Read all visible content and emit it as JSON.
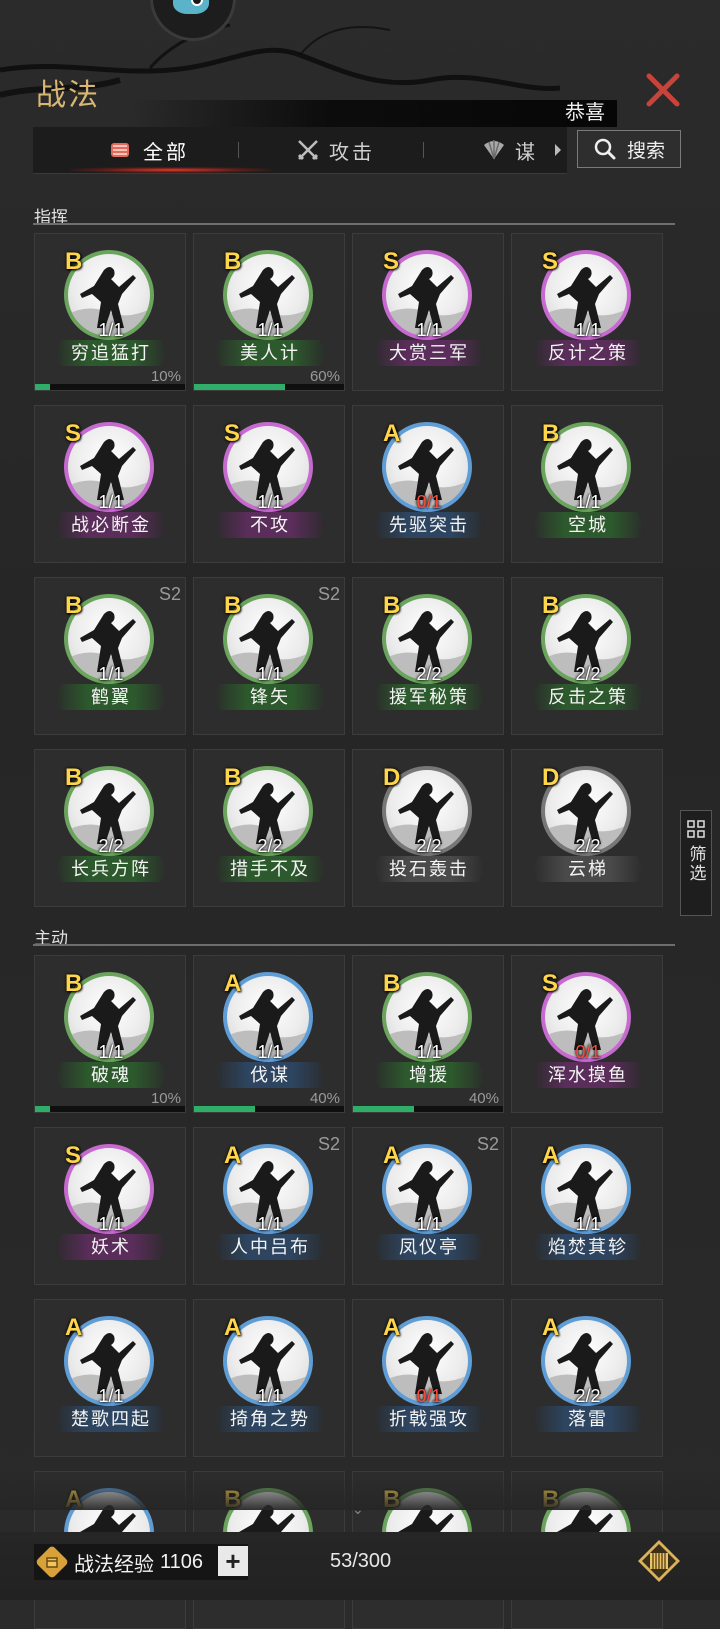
{
  "header": {
    "title": "战法",
    "notice": "恭喜"
  },
  "tabs": [
    {
      "label": "全部",
      "icon": "scroll-icon",
      "active": true
    },
    {
      "label": "攻击",
      "icon": "crossed-swords-icon",
      "active": false
    },
    {
      "label": "谋",
      "icon": "fan-icon",
      "active": false
    }
  ],
  "search": {
    "label": "搜索"
  },
  "sections": [
    {
      "title": "指挥"
    },
    {
      "title": "主动"
    }
  ],
  "command_cards": [
    {
      "grade": "B",
      "name": "穷追猛打",
      "count": "1/1",
      "count_red": false,
      "season": "",
      "pct": "10%",
      "progress": 0.1
    },
    {
      "grade": "B",
      "name": "美人计",
      "count": "1/1",
      "count_red": false,
      "season": "",
      "pct": "60%",
      "progress": 0.6
    },
    {
      "grade": "S",
      "name": "大赏三军",
      "count": "1/1",
      "count_red": false,
      "season": "",
      "pct": "",
      "progress": null
    },
    {
      "grade": "S",
      "name": "反计之策",
      "count": "1/1",
      "count_red": false,
      "season": "",
      "pct": "",
      "progress": null
    },
    {
      "grade": "S",
      "name": "战必断金",
      "count": "1/1",
      "count_red": false,
      "season": "",
      "pct": "",
      "progress": null
    },
    {
      "grade": "S",
      "name": "不攻",
      "count": "1/1",
      "count_red": false,
      "season": "",
      "pct": "",
      "progress": null
    },
    {
      "grade": "A",
      "name": "先驱突击",
      "count": "0/1",
      "count_red": true,
      "season": "",
      "pct": "",
      "progress": null
    },
    {
      "grade": "B",
      "name": "空城",
      "count": "1/1",
      "count_red": false,
      "season": "",
      "pct": "",
      "progress": null
    },
    {
      "grade": "B",
      "name": "鹤翼",
      "count": "1/1",
      "count_red": false,
      "season": "S2",
      "pct": "",
      "progress": null
    },
    {
      "grade": "B",
      "name": "锋矢",
      "count": "1/1",
      "count_red": false,
      "season": "S2",
      "pct": "",
      "progress": null
    },
    {
      "grade": "B",
      "name": "援军秘策",
      "count": "2/2",
      "count_red": false,
      "season": "",
      "pct": "",
      "progress": null
    },
    {
      "grade": "B",
      "name": "反击之策",
      "count": "2/2",
      "count_red": false,
      "season": "",
      "pct": "",
      "progress": null
    },
    {
      "grade": "B",
      "name": "长兵方阵",
      "count": "2/2",
      "count_red": false,
      "season": "",
      "pct": "",
      "progress": null
    },
    {
      "grade": "B",
      "name": "措手不及",
      "count": "2/2",
      "count_red": false,
      "season": "",
      "pct": "",
      "progress": null
    },
    {
      "grade": "D",
      "name": "投石轰击",
      "count": "2/2",
      "count_red": false,
      "season": "",
      "pct": "",
      "progress": null
    },
    {
      "grade": "D",
      "name": "云梯",
      "count": "2/2",
      "count_red": false,
      "season": "",
      "pct": "",
      "progress": null
    }
  ],
  "active_cards": [
    {
      "grade": "B",
      "name": "破魂",
      "count": "1/1",
      "count_red": false,
      "season": "",
      "pct": "10%",
      "progress": 0.1
    },
    {
      "grade": "A",
      "name": "伐谋",
      "count": "1/1",
      "count_red": false,
      "season": "",
      "pct": "40%",
      "progress": 0.4
    },
    {
      "grade": "B",
      "name": "增援",
      "count": "1/1",
      "count_red": false,
      "season": "",
      "pct": "40%",
      "progress": 0.4
    },
    {
      "grade": "S",
      "name": "浑水摸鱼",
      "count": "0/1",
      "count_red": true,
      "season": "",
      "pct": "",
      "progress": null
    },
    {
      "grade": "S",
      "name": "妖术",
      "count": "1/1",
      "count_red": false,
      "season": "",
      "pct": "",
      "progress": null
    },
    {
      "grade": "A",
      "name": "人中吕布",
      "count": "1/1",
      "count_red": false,
      "season": "S2",
      "pct": "",
      "progress": null
    },
    {
      "grade": "A",
      "name": "凤仪亭",
      "count": "1/1",
      "count_red": false,
      "season": "S2",
      "pct": "",
      "progress": null
    },
    {
      "grade": "A",
      "name": "焰焚萁轸",
      "count": "1/1",
      "count_red": false,
      "season": "",
      "pct": "",
      "progress": null
    },
    {
      "grade": "A",
      "name": "楚歌四起",
      "count": "1/1",
      "count_red": false,
      "season": "",
      "pct": "",
      "progress": null
    },
    {
      "grade": "A",
      "name": "掎角之势",
      "count": "1/1",
      "count_red": false,
      "season": "",
      "pct": "",
      "progress": null
    },
    {
      "grade": "A",
      "name": "折戟强攻",
      "count": "0/1",
      "count_red": true,
      "season": "",
      "pct": "",
      "progress": null
    },
    {
      "grade": "A",
      "name": "落雷",
      "count": "2/2",
      "count_red": false,
      "season": "",
      "pct": "",
      "progress": null
    },
    {
      "grade": "A",
      "name": "",
      "count": "",
      "count_red": false,
      "season": "",
      "pct": "",
      "progress": null
    },
    {
      "grade": "B",
      "name": "",
      "count": "",
      "count_red": false,
      "season": "",
      "pct": "",
      "progress": null
    },
    {
      "grade": "B",
      "name": "",
      "count": "",
      "count_red": false,
      "season": "",
      "pct": "",
      "progress": null
    },
    {
      "grade": "B",
      "name": "",
      "count": "",
      "count_red": false,
      "season": "",
      "pct": "",
      "progress": null
    }
  ],
  "grade_colors": {
    "S": "#c66ad0",
    "A": "#5f9dd6",
    "B": "#6aa45d",
    "D": "#777777"
  },
  "filter": {
    "label": "筛选"
  },
  "footer": {
    "exp_label": "战法经验",
    "exp_value": "1106",
    "plus": "+",
    "capacity": "53/300"
  }
}
